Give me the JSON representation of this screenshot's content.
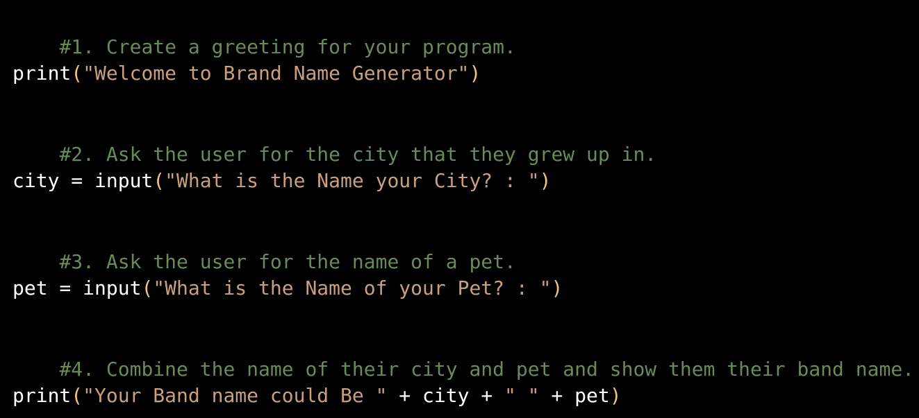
{
  "colors": {
    "background": "#000000",
    "comment": "#6a8a5a",
    "plain": "#ffffff",
    "paren": "#f0c77a",
    "string": "#c8a07d"
  },
  "lines": [
    {
      "comment": "#1. Create a greeting for your program."
    },
    {
      "fn": "print",
      "open": "(",
      "str": "\"Welcome to Brand Name Generator\"",
      "close": ")"
    },
    {
      "comment": "#2. Ask the user for the city that they grew up in."
    },
    {
      "lhs": "city = input",
      "open": "(",
      "str": "\"What is the Name your City? : \"",
      "close": ")"
    },
    {
      "comment": "#3. Ask the user for the name of a pet."
    },
    {
      "lhs": "pet = input",
      "open": "(",
      "str": "\"What is the Name of your Pet? : \"",
      "close": ")"
    },
    {
      "comment": "#4. Combine the name of their city and pet and show them their band name."
    },
    {
      "fn": "print",
      "open": "(",
      "str1": "\"Your Band name could Be \"",
      "mid": " + city + ",
      "str2": "\" \"",
      "tail": " + pet",
      "close": ")"
    }
  ]
}
